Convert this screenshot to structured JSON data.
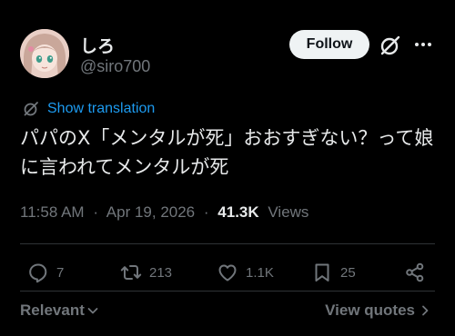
{
  "author": {
    "display_name": "しろ",
    "handle": "@siro700"
  },
  "header": {
    "follow_label": "Follow"
  },
  "translation": {
    "label": "Show translation"
  },
  "tweet": {
    "text": "パパのX「メンタルが死」おおすぎない？って娘に言われてメンタルが死"
  },
  "meta": {
    "time": "11:58 AM",
    "separator": "·",
    "date": "Apr 19, 2026",
    "views_count": "41.3K",
    "views_label": "Views"
  },
  "actions": {
    "replies": "7",
    "reposts": "213",
    "likes": "1.1K",
    "bookmarks": "25"
  },
  "footer": {
    "sort_label": "Relevant",
    "quotes_label": "View quotes"
  },
  "colors": {
    "background": "#000000",
    "text": "#e7e9ea",
    "muted": "#71767b",
    "accent": "#1d9bf0",
    "follow_bg": "#eff3f4"
  },
  "icons": [
    "grok-icon",
    "more-icon",
    "translate-icon",
    "reply-icon",
    "repost-icon",
    "like-icon",
    "bookmark-icon",
    "share-icon",
    "chevron-down-icon",
    "chevron-right-icon"
  ]
}
